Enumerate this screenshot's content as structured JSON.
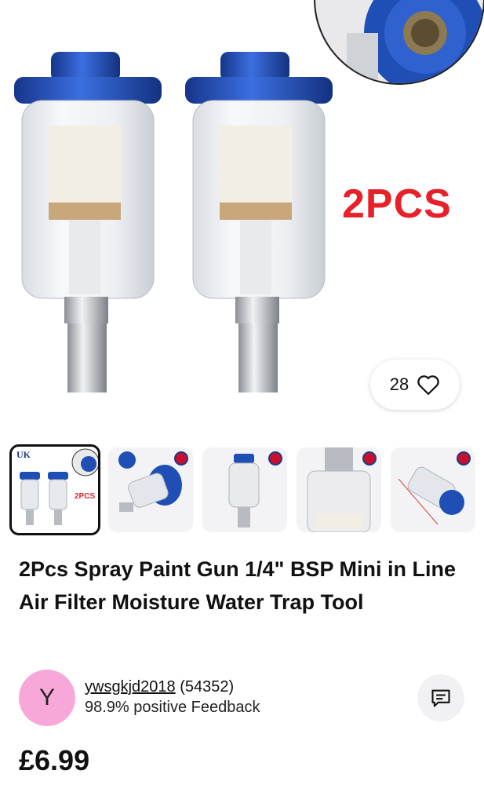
{
  "hero": {
    "badge_text": "2PCS",
    "like_count": "28",
    "like_icon": "heart-outline-icon",
    "colors": {
      "badge": "#e8202a",
      "cap_blue": "#1f4fb5"
    }
  },
  "thumbnails": [
    {
      "name": "thumb-1",
      "label_uk": "UK",
      "label_2pcs": "2PCS",
      "selected": true
    },
    {
      "name": "thumb-2",
      "selected": false
    },
    {
      "name": "thumb-3",
      "selected": false
    },
    {
      "name": "thumb-4",
      "selected": false
    },
    {
      "name": "thumb-5",
      "selected": false
    }
  ],
  "listing": {
    "title": "2Pcs Spray Paint Gun 1/4\" BSP Mini in Line Air Filter Moisture Water Trap Tool",
    "price": "£6.99"
  },
  "seller": {
    "avatar_letter": "Y",
    "name": "ywsgkjd2018",
    "score": "(54352)",
    "feedback": "98.9% positive Feedback",
    "avatar_color": "#f7a8d8",
    "message_icon": "message-icon"
  }
}
